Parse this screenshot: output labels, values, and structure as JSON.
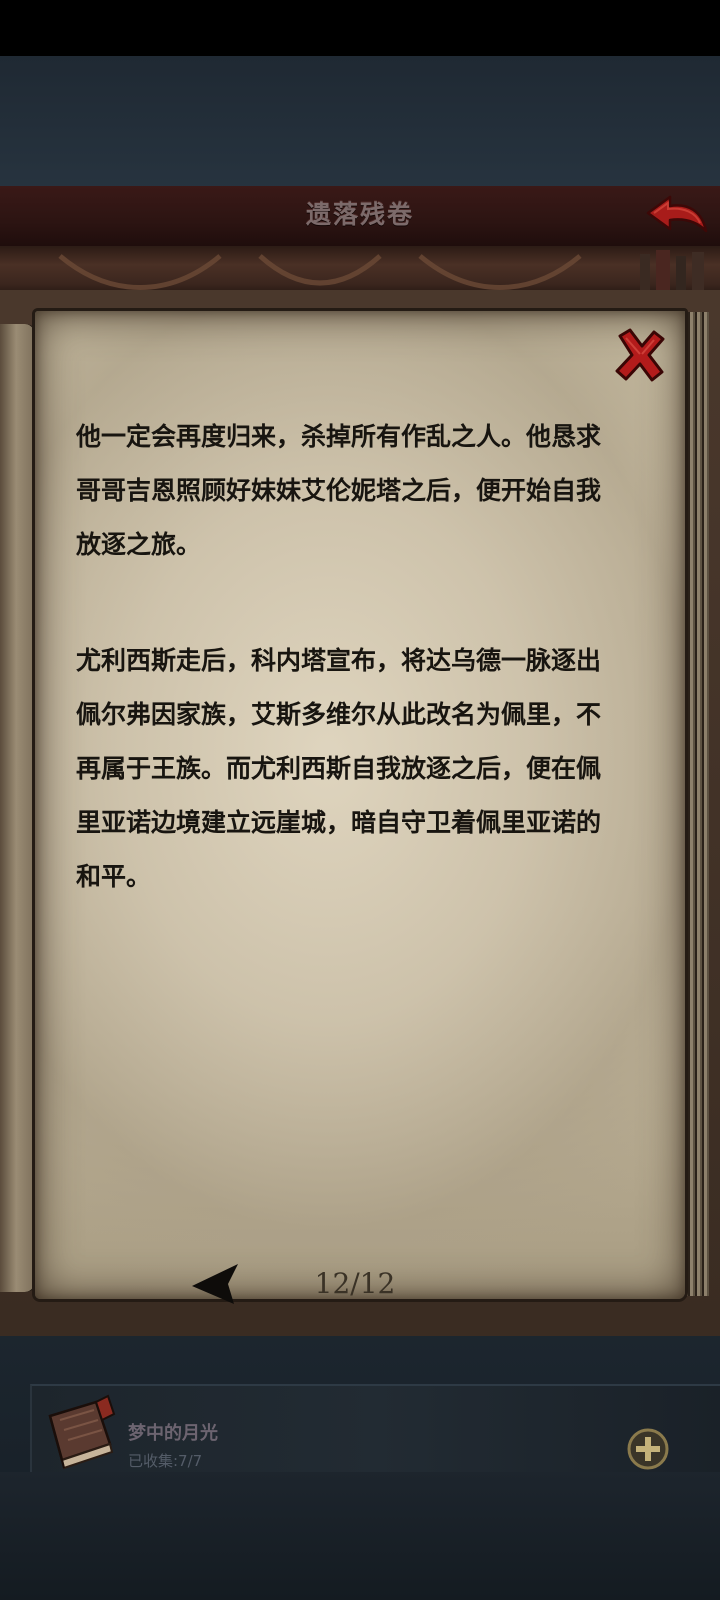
{
  "header": {
    "title": "遗落残卷"
  },
  "icons": {
    "back": "back-arrow-icon",
    "close": "close-x-icon",
    "prev_page": "left-arrow-icon",
    "collection": "book-icon",
    "add": "plus-circle-icon"
  },
  "page": {
    "paragraphs": [
      "他一定会再度归来，杀掉所有作乱之人。他恳求哥哥吉恩照顾好妹妹艾伦妮塔之后，便开始自我放逐之旅。",
      "尤利西斯走后，科内塔宣布，将达乌德一脉逐出佩尔弗因家族，艾斯多维尔从此改名为佩里，不再属于王族。而尤利西斯自我放逐之后，便在佩里亚诺边境建立远崖城，暗自守卫着佩里亚诺的和平。"
    ],
    "counter": "12/12"
  },
  "collection": {
    "name": "梦中的月光",
    "progress": "已收集:7/7"
  },
  "colors": {
    "header_bg": "#2c1412",
    "accent_red": "#b31b1b",
    "parchment": "#cbbfa5",
    "text": "#181510",
    "backdrop": "#24303b"
  }
}
